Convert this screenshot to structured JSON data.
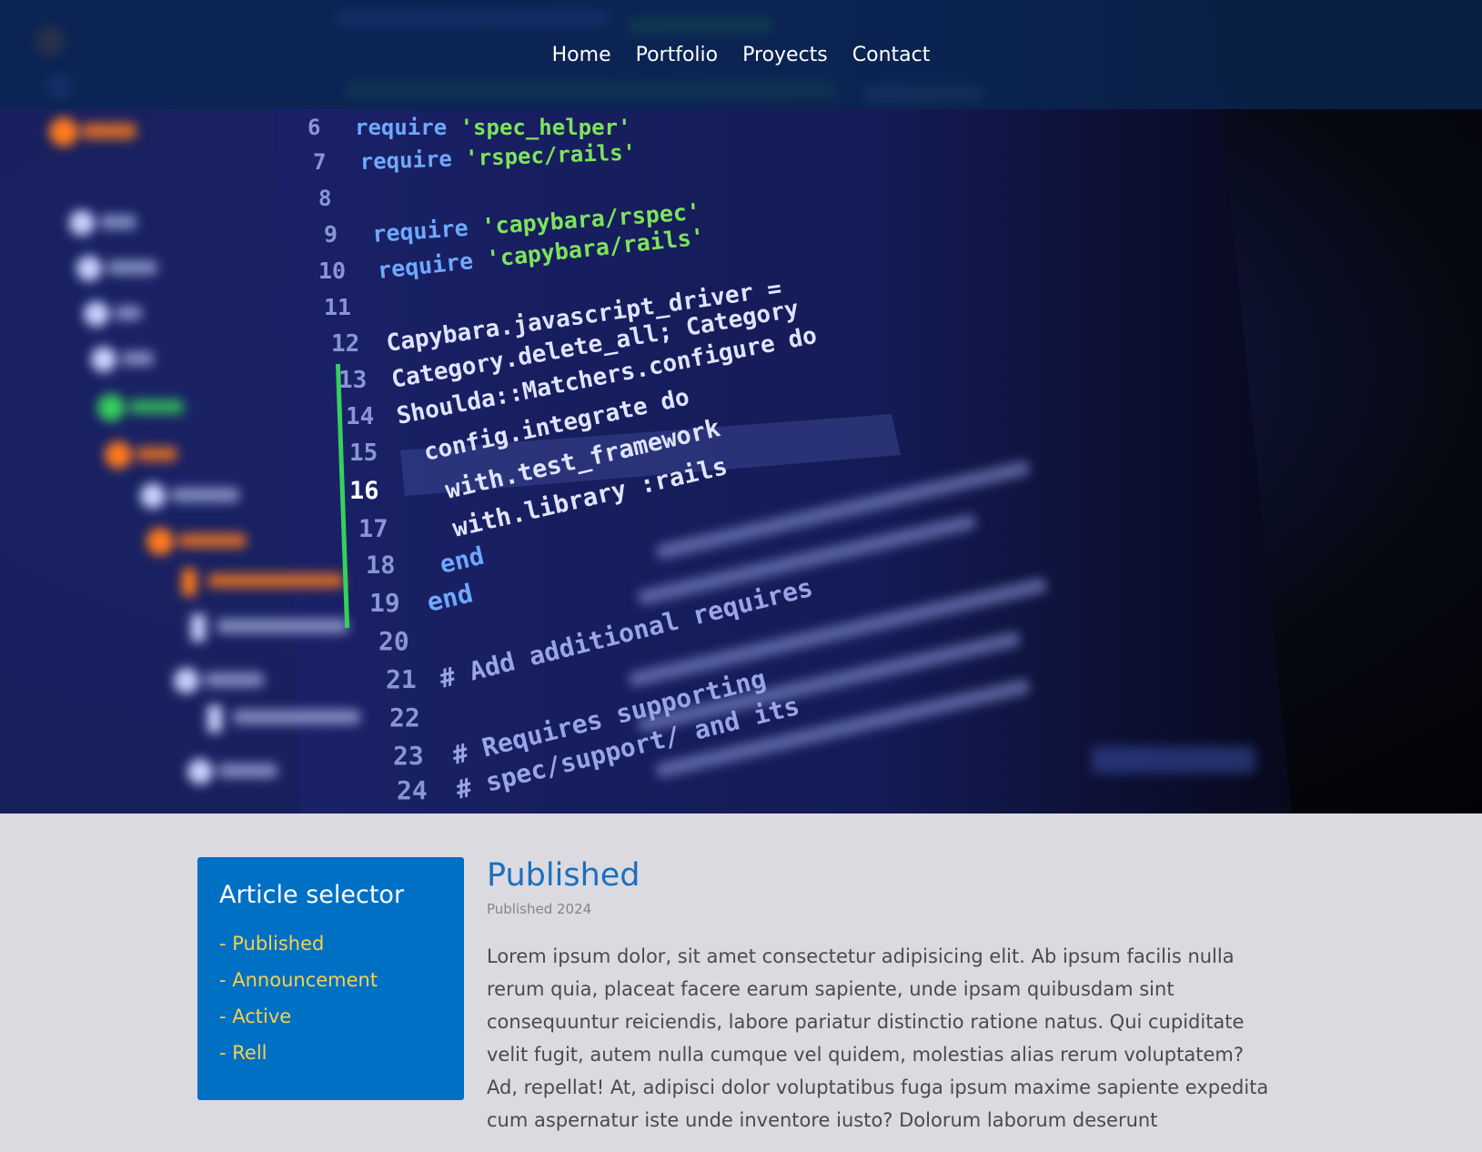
{
  "nav": {
    "items": [
      {
        "label": "Home"
      },
      {
        "label": "Portfolio"
      },
      {
        "label": "Proyects"
      },
      {
        "label": "Contact"
      }
    ]
  },
  "hero": {
    "code_lines": [
      {
        "num": "6",
        "kw": "require",
        "str": "'spec_helper'"
      },
      {
        "num": "7",
        "kw": "require",
        "str": "'rspec/rails'"
      },
      {
        "num": "8",
        "kw": "",
        "str": ""
      },
      {
        "num": "9",
        "kw": "require",
        "str": "'capybara/rspec'"
      },
      {
        "num": "10",
        "kw": "require",
        "str": "'capybara/rails'"
      },
      {
        "num": "11",
        "kw": "",
        "str": ""
      },
      {
        "num": "12",
        "text": "Capybara.javascript_driver ="
      },
      {
        "num": "13",
        "text": "Category.delete_all; Category"
      },
      {
        "num": "14",
        "text": "Shoulda::Matchers.configure do"
      },
      {
        "num": "15",
        "text": "  config.integrate do"
      },
      {
        "num": "16",
        "text": "    with.test_framework"
      },
      {
        "num": "17",
        "text": "    with.library :rails"
      },
      {
        "num": "18",
        "text": "  end"
      },
      {
        "num": "19",
        "text": "end"
      },
      {
        "num": "20",
        "text": ""
      },
      {
        "num": "21",
        "text": "# Add additional requires"
      },
      {
        "num": "22",
        "text": ""
      },
      {
        "num": "23",
        "text": "# Requires supporting"
      },
      {
        "num": "24",
        "text": "# spec/support/ and its"
      }
    ],
    "colors": {
      "keyword": "#6fa8ff",
      "string": "#7ee35b",
      "text": "#dfe4ff",
      "line_number": "#8b95d4",
      "comment": "#9aa4e8"
    }
  },
  "sidebar": {
    "title": "Article selector",
    "items": [
      {
        "label": "- Published"
      },
      {
        "label": "- Announcement"
      },
      {
        "label": "- Active"
      },
      {
        "label": "- Rell"
      }
    ]
  },
  "article": {
    "title": "Published",
    "date": "Published 2024",
    "body": "Lorem ipsum dolor, sit amet consectetur adipisicing elit. Ab ipsum facilis nulla rerum quia, placeat facere earum sapiente, unde ipsam quibusdam sint consequuntur reiciendis, labore pariatur distinctio ratione natus. Qui cupiditate velit fugit, autem nulla cumque vel quidem, molestias alias rerum voluptatem? Ad, repellat! At, adipisci dolor voluptatibus fuga ipsum maxime sapiente expedita cum aspernatur iste unde inventore iusto? Dolorum laborum deserunt"
  },
  "colors": {
    "navbar": "#0a2650",
    "panel": "#0070c5",
    "panel_link": "#f5d24a",
    "page_bg": "#dcdae1",
    "title": "#1b6fbd"
  }
}
